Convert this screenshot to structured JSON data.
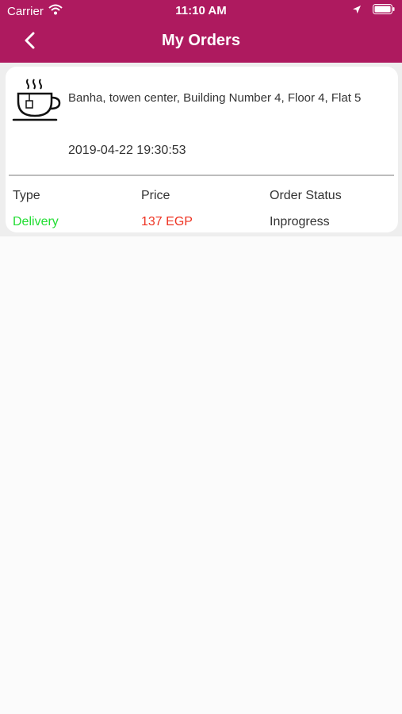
{
  "status_bar": {
    "carrier": "Carrier",
    "time": "11:10 AM"
  },
  "nav": {
    "title": "My Orders"
  },
  "order": {
    "address": "Banha, towen center, Building Number 4, Floor 4, Flat 5",
    "datetime": "2019-04-22 19:30:53",
    "columns": {
      "type_label": "Type",
      "price_label": "Price",
      "status_label": "Order Status"
    },
    "type": "Delivery",
    "price": "137 EGP",
    "status": "Inprogress"
  },
  "colors": {
    "header": "#ae1a5f",
    "type_value": "#22dd33",
    "price_value": "#ee3322"
  },
  "icons": [
    "wifi-icon",
    "location-arrow-icon",
    "battery-icon",
    "back-chevron-icon",
    "tea-cup-icon"
  ]
}
